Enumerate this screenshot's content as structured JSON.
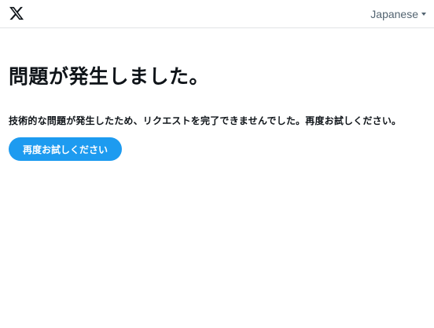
{
  "header": {
    "logo_icon": "x-logo-icon",
    "language_label": "Japanese",
    "language_icon": "caret-down-icon"
  },
  "main": {
    "title": "問題が発生しました。",
    "message": "技術的な問題が発生したため、リクエストを完了できませんでした。再度お試しください。",
    "retry_label": "再度お試しください"
  },
  "colors": {
    "accent": "#1d9bf0",
    "text": "#0f1419",
    "muted": "#536471",
    "border": "#e1e4e6",
    "background": "#ffffff"
  }
}
